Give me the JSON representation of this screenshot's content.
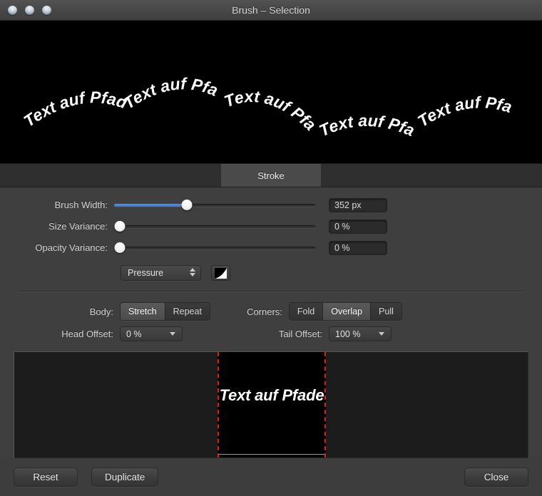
{
  "window": {
    "title": "Brush – Selection",
    "traffic_lights": [
      "close-button",
      "minimize-button",
      "zoom-button"
    ]
  },
  "canvas": {
    "background": "#000000",
    "stroke_text": "Text auf Pfade",
    "instances": 5
  },
  "tabs": [
    {
      "label": "Stroke",
      "active": true
    }
  ],
  "stroke": {
    "brush_width": {
      "label": "Brush Width:",
      "value": "352 px",
      "slider_percent": 36,
      "fill_color": "#4a80cf"
    },
    "size_variance": {
      "label": "Size Variance:",
      "value": "0 %",
      "slider_percent": 0
    },
    "opacity_variance": {
      "label": "Opacity Variance:",
      "value": "0 %",
      "slider_percent": 0
    },
    "dynamics": {
      "selected": "Pressure",
      "falloff_icon": "gradient-ramp-icon"
    },
    "body": {
      "label": "Body:",
      "options": [
        "Stretch",
        "Repeat"
      ],
      "selected": "Stretch"
    },
    "corners": {
      "label": "Corners:",
      "options": [
        "Fold",
        "Overlap",
        "Pull"
      ],
      "selected": "Overlap"
    },
    "head_offset": {
      "label": "Head Offset:",
      "value": "0 %"
    },
    "tail_offset": {
      "label": "Tail Offset:",
      "value": "100 %"
    }
  },
  "preview": {
    "text": "Text auf Pfade",
    "guide_color": "#e01b1b"
  },
  "footer": {
    "reset": "Reset",
    "duplicate": "Duplicate",
    "close": "Close"
  }
}
